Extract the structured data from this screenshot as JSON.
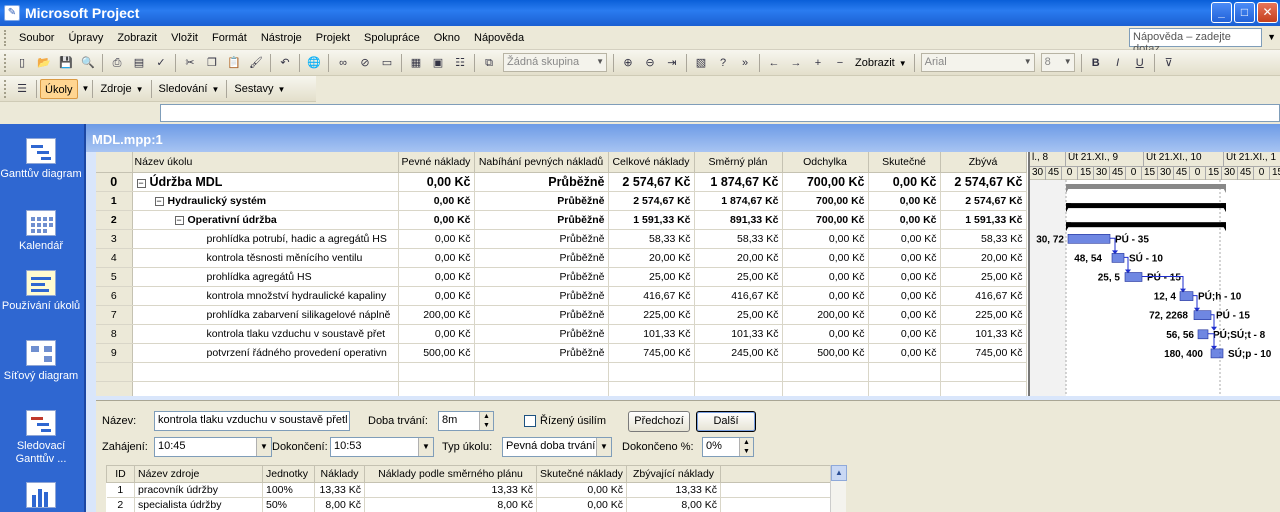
{
  "window": {
    "title": "Microsoft Project",
    "min": "_",
    "max": "□",
    "close": "✕"
  },
  "menu": [
    "Soubor",
    "Úpravy",
    "Zobrazit",
    "Vložit",
    "Formát",
    "Nástroje",
    "Projekt",
    "Spolupráce",
    "Okno",
    "Nápověda"
  ],
  "help_placeholder": "Nápověda – zadejte dotaz",
  "toolbar": {
    "group_combo": "Žádná skupina",
    "show_label": "Zobrazit",
    "font_combo": "Arial",
    "size_combo": "8",
    "bold": "B",
    "italic": "I",
    "underline": "U",
    "tasks_btn": "Úkoly",
    "resources_btn": "Zdroje",
    "tracking_btn": "Sledování",
    "reports_btn": "Sestavy"
  },
  "viewbar": [
    {
      "label": "Ganttův diagram"
    },
    {
      "label": "Kalendář"
    },
    {
      "label": "Používání úkolů"
    },
    {
      "label": "Síťový diagram"
    },
    {
      "label": "Sledovací Ganttův ..."
    }
  ],
  "document": {
    "title": "MDL.mpp:1"
  },
  "columns": [
    "",
    "Název úkolu",
    "Pevné náklady",
    "Nabíhání pevných nákladů",
    "Celkové náklady",
    "Směrný plán",
    "Odchylka",
    "Skutečné",
    "Zbývá"
  ],
  "tasks": [
    {
      "id": "0",
      "name": "Údržba MDL",
      "level": 0,
      "summary": true,
      "fixed": "0,00 Kč",
      "accrue": "Průběžně",
      "total": "2 574,67 Kč",
      "baseline": "1 874,67 Kč",
      "variance": "700,00 Kč",
      "actual": "0,00 Kč",
      "remaining": "2 574,67 Kč"
    },
    {
      "id": "1",
      "name": "Hydraulický systém",
      "level": 1,
      "summary": true,
      "fixed": "0,00 Kč",
      "accrue": "Průběžně",
      "total": "2 574,67 Kč",
      "baseline": "1 874,67 Kč",
      "variance": "700,00 Kč",
      "actual": "0,00 Kč",
      "remaining": "2 574,67 Kč"
    },
    {
      "id": "2",
      "name": "Operativní údržba",
      "level": 2,
      "summary": true,
      "fixed": "0,00 Kč",
      "accrue": "Průběžně",
      "total": "1 591,33 Kč",
      "baseline": "891,33 Kč",
      "variance": "700,00 Kč",
      "actual": "0,00 Kč",
      "remaining": "1 591,33 Kč"
    },
    {
      "id": "3",
      "name": "prohlídka potrubí, hadic a agregátů HS",
      "level": 3,
      "summary": false,
      "fixed": "0,00 Kč",
      "accrue": "Průběžně",
      "total": "58,33 Kč",
      "baseline": "58,33 Kč",
      "variance": "0,00 Kč",
      "actual": "0,00 Kč",
      "remaining": "58,33 Kč"
    },
    {
      "id": "4",
      "name": "kontrola těsnosti měnícího ventilu",
      "level": 3,
      "summary": false,
      "fixed": "0,00 Kč",
      "accrue": "Průběžně",
      "total": "20,00 Kč",
      "baseline": "20,00 Kč",
      "variance": "0,00 Kč",
      "actual": "0,00 Kč",
      "remaining": "20,00 Kč"
    },
    {
      "id": "5",
      "name": "prohlídka agregátů HS",
      "level": 3,
      "summary": false,
      "fixed": "0,00 Kč",
      "accrue": "Průběžně",
      "total": "25,00 Kč",
      "baseline": "25,00 Kč",
      "variance": "0,00 Kč",
      "actual": "0,00 Kč",
      "remaining": "25,00 Kč"
    },
    {
      "id": "6",
      "name": "kontrola množství hydraulické kapaliny",
      "level": 3,
      "summary": false,
      "fixed": "0,00 Kč",
      "accrue": "Průběžně",
      "total": "416,67 Kč",
      "baseline": "416,67 Kč",
      "variance": "0,00 Kč",
      "actual": "0,00 Kč",
      "remaining": "416,67 Kč"
    },
    {
      "id": "7",
      "name": "prohlídka zabarvení silikagelové náplně",
      "level": 3,
      "summary": false,
      "fixed": "200,00 Kč",
      "accrue": "Průběžně",
      "total": "225,00 Kč",
      "baseline": "25,00 Kč",
      "variance": "200,00 Kč",
      "actual": "0,00 Kč",
      "remaining": "225,00 Kč"
    },
    {
      "id": "8",
      "name": "kontrola tlaku vzduchu v soustavě přet",
      "level": 3,
      "summary": false,
      "fixed": "0,00 Kč",
      "accrue": "Průběžně",
      "total": "101,33 Kč",
      "baseline": "101,33 Kč",
      "variance": "0,00 Kč",
      "actual": "0,00 Kč",
      "remaining": "101,33 Kč"
    },
    {
      "id": "9",
      "name": "potvrzení řádného provedení operativn",
      "level": 3,
      "summary": false,
      "fixed": "500,00 Kč",
      "accrue": "Průběžně",
      "total": "745,00 Kč",
      "baseline": "245,00 Kč",
      "variance": "500,00 Kč",
      "actual": "0,00 Kč",
      "remaining": "745,00 Kč"
    }
  ],
  "gantt": {
    "major": [
      "l., 8",
      "Út 21.XI., 9",
      "Út 21.XI., 10",
      "Út 21.XI., 1"
    ],
    "minor": [
      "30",
      "45",
      "0",
      "15",
      "30",
      "45",
      "0",
      "15",
      "30",
      "45",
      "0",
      "15",
      "30",
      "45",
      "0",
      "15"
    ],
    "labels": [
      {
        "left": "30, 72",
        "right": "PÚ - 35"
      },
      {
        "left": "48, 54",
        "right": "SÚ - 10"
      },
      {
        "left": "25, 5",
        "right": "PÚ - 15"
      },
      {
        "left": "12, 4",
        "right": "PÚ;h - 10"
      },
      {
        "left": "72, 2268",
        "right": "PÚ - 15"
      },
      {
        "left": "56, 56",
        "right": "PÚ;SÚ;t - 8"
      },
      {
        "left": "180, 400",
        "right": "SÚ;p - 10"
      }
    ],
    "bar_color": "#3f5fd8"
  },
  "form": {
    "name_label": "Název:",
    "name_value": "kontrola tlaku vzduchu v soustavě přetl",
    "duration_label": "Doba trvání:",
    "duration_value": "8m",
    "effort_label": "Řízený úsilím",
    "prev_btn": "Předchozí",
    "next_btn": "Další",
    "start_label": "Zahájení:",
    "start_value": "10:45",
    "finish_label": "Dokončení:",
    "finish_value": "10:53",
    "type_label": "Typ úkolu:",
    "type_value": "Pevná doba trvání",
    "complete_label": "Dokončeno %:",
    "complete_value": "0%"
  },
  "resources": {
    "columns": [
      "ID",
      "Název zdroje",
      "Jednotky",
      "Náklady",
      "Náklady podle směrného plánu",
      "Skutečné náklady",
      "Zbývající náklady"
    ],
    "rows": [
      {
        "id": "1",
        "name": "pracovník údržby",
        "units": "100%",
        "cost": "13,33 Kč",
        "baseline": "13,33 Kč",
        "actual": "0,00 Kč",
        "remaining": "13,33 Kč"
      },
      {
        "id": "2",
        "name": "specialista údržby",
        "units": "50%",
        "cost": "8,00 Kč",
        "baseline": "8,00 Kč",
        "actual": "0,00 Kč",
        "remaining": "8,00 Kč"
      }
    ]
  }
}
